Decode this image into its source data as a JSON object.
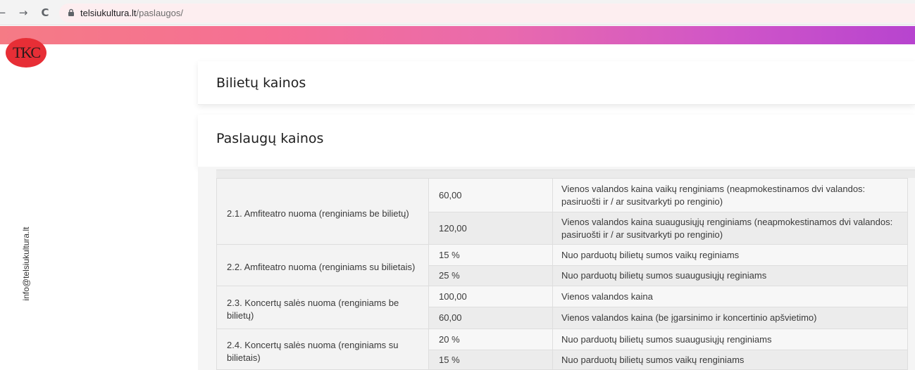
{
  "browser": {
    "domain": "telsiukultura.lt",
    "path": "/paslaugos/"
  },
  "logo": {
    "text": "TKC"
  },
  "side": {
    "email": "info@telsiukultura.lt"
  },
  "sections": {
    "tickets_title": "Bilietų kainos",
    "services_title": "Paslaugų kainos"
  },
  "table": {
    "groups": [
      {
        "service": "2.1. Amfiteatro nuoma (renginiams be bilietų)",
        "rows": [
          {
            "price": "60,00",
            "desc": "Vienos valandos kaina vaikų renginiams (neapmokestinamos dvi valandos: pasiruošti ir / ar susitvarkyti po renginio)"
          },
          {
            "price": "120,00",
            "desc": "Vienos valandos kaina suaugusiųjų renginiams (neapmokestinamos dvi valandos: pasiruošti ir / ar susitvarkyti po renginio)"
          }
        ]
      },
      {
        "service": "2.2. Amfiteatro nuoma (renginiams su bilietais)",
        "rows": [
          {
            "price": "15 %",
            "desc": "Nuo parduotų bilietų sumos vaikų reginiams"
          },
          {
            "price": "25 %",
            "desc": "Nuo parduotų bilietų sumos suaugusiųjų reginiams"
          }
        ]
      },
      {
        "service": "2.3. Koncertų salės nuoma (renginiams be bilietų)",
        "rows": [
          {
            "price": "100,00",
            "desc": "Vienos valandos kaina"
          },
          {
            "price": "60,00",
            "desc": "Vienos valandos kaina (be įgarsinimo ir koncertinio apšvietimo)"
          }
        ]
      },
      {
        "service": "2.4. Koncertų salės nuoma (renginiams su bilietais)",
        "rows": [
          {
            "price": "20 %",
            "desc": "Nuo parduotų bilietų sumos suaugusiųjų renginiams"
          },
          {
            "price": "15 %",
            "desc": "Nuo parduotų bilietų sumos vaikų renginiams"
          }
        ]
      }
    ]
  }
}
